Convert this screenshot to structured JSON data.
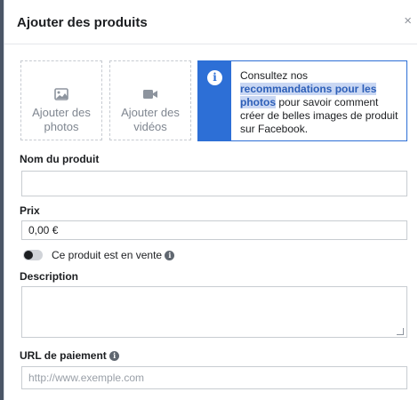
{
  "header": {
    "title": "Ajouter des produits",
    "close_glyph": "×"
  },
  "media": {
    "photos_label": "Ajouter des photos",
    "videos_label": "Ajouter des vidéos",
    "photos_icon": "image-icon",
    "videos_icon": "video-camera-icon"
  },
  "info": {
    "icon": "i",
    "text_before": "Consultez nos ",
    "link_text": "recommandations pour les photos",
    "text_after": " pour savoir comment créer de belles images de produit sur Facebook."
  },
  "form": {
    "name_label": "Nom du produit",
    "name_value": "",
    "price_label": "Prix",
    "price_value": "0,00 €",
    "on_sale_label": "Ce produit est en vente",
    "on_sale": false,
    "description_label": "Description",
    "description_value": "",
    "payment_url_label": "URL de paiement",
    "payment_url_placeholder": "http://www.exemple.com"
  },
  "colors": {
    "accent": "#2d6fd6",
    "text": "#1c1e21",
    "border": "#c8ccd1"
  }
}
